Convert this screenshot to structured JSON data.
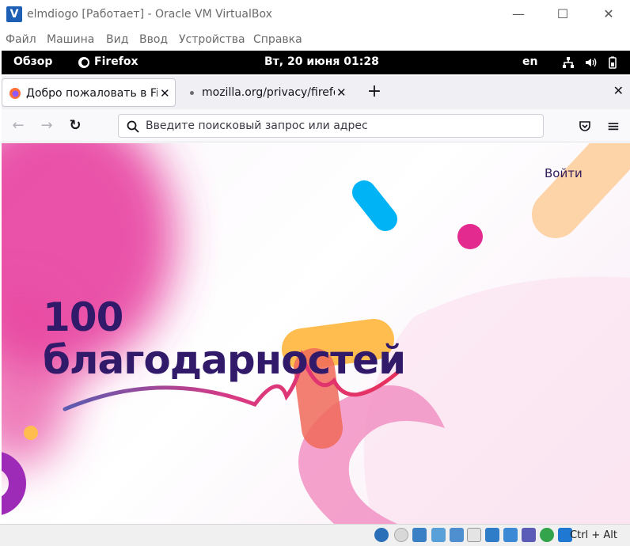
{
  "window": {
    "title": "elmdiogo [Работает] - Oracle VM VirtualBox",
    "controls": {
      "minimize": "—",
      "maximize": "☐",
      "close": "✕"
    }
  },
  "vb_menu": [
    "Файл",
    "Машина",
    "Вид",
    "Ввод",
    "Устройства",
    "Справка"
  ],
  "gnome": {
    "activities": "Обзор",
    "app": "Firefox",
    "clock": "Вт, 20 июня  01:28",
    "lang": "en"
  },
  "tabs": [
    {
      "label": "Добро пожаловать в Firefox",
      "close": "✕"
    },
    {
      "label": "mozilla.org/privacy/firefox",
      "close": "✕"
    }
  ],
  "tabstrip": {
    "new_tab": "+",
    "close_window": "✕"
  },
  "navbar": {
    "back": "←",
    "forward": "→",
    "reload": "↻",
    "url_placeholder": "Введите поисковый запрос или адрес",
    "menu": "≡"
  },
  "page": {
    "signin": "Войти",
    "headline_line1": "100",
    "headline_line2": "благодарностей"
  },
  "statusbar": {
    "hostkey": "Ctrl + Alt"
  },
  "colors": {
    "headline": "#321a6b",
    "pink": "#e6359a",
    "blue": "#00b3f4",
    "orange": "#ffbd4f",
    "purple": "#9e2ab8"
  }
}
